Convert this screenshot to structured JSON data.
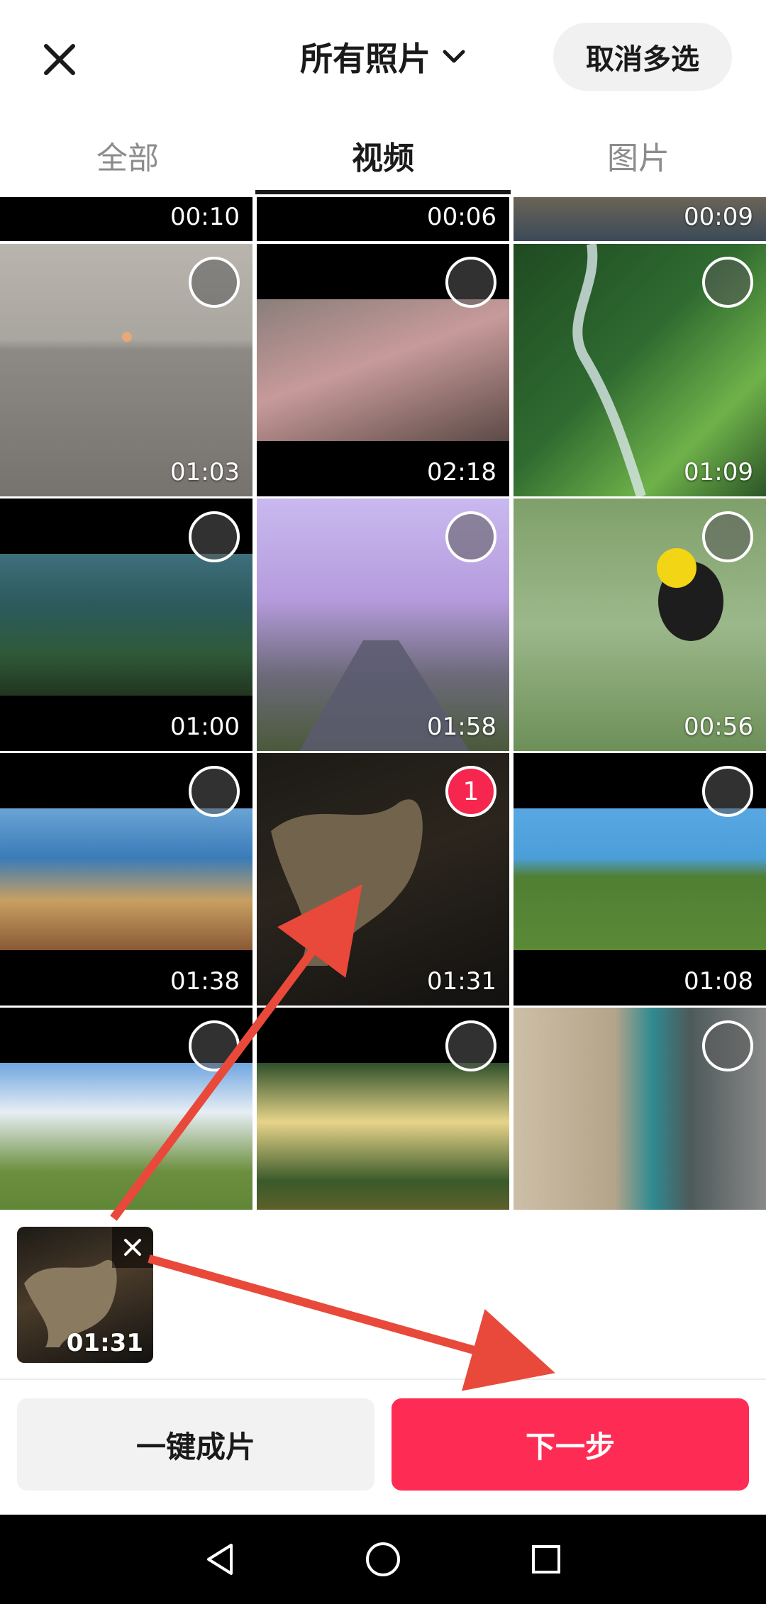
{
  "header": {
    "album_title": "所有照片",
    "cancel_multi_label": "取消多选"
  },
  "tabs": [
    {
      "label": "全部",
      "active": false
    },
    {
      "label": "视频",
      "active": true
    },
    {
      "label": "图片",
      "active": false
    }
  ],
  "grid": {
    "top_row_partial_durations": [
      "00:10",
      "00:06",
      "00:09"
    ],
    "items": [
      {
        "duration": "01:03",
        "thumb": "sea-sunset"
      },
      {
        "duration": "02:18",
        "thumb": "close-up-face"
      },
      {
        "duration": "01:09",
        "thumb": "aerial-forest-river"
      },
      {
        "duration": "01:00",
        "thumb": "mountain-cliffs"
      },
      {
        "duration": "01:58",
        "thumb": "cherry-blossom-road"
      },
      {
        "duration": "00:56",
        "thumb": "yellow-headed-bird"
      },
      {
        "duration": "01:38",
        "thumb": "coastal-rocks-beach"
      },
      {
        "duration": "01:31",
        "thumb": "rock-arch-dark",
        "selected_index": "1"
      },
      {
        "duration": "01:08",
        "thumb": "green-cliffs-sea"
      },
      {
        "duration": "",
        "thumb": "grassland-mountain"
      },
      {
        "duration": "",
        "thumb": "forest-sunlight"
      },
      {
        "duration": "",
        "thumb": "aerial-bridge-water"
      }
    ]
  },
  "tray": {
    "selected_duration": "01:31"
  },
  "actions": {
    "one_click_label": "一键成片",
    "next_label": "下一步"
  },
  "colors": {
    "accent": "#fe2c55",
    "annotation_arrow": "#e8493a"
  }
}
